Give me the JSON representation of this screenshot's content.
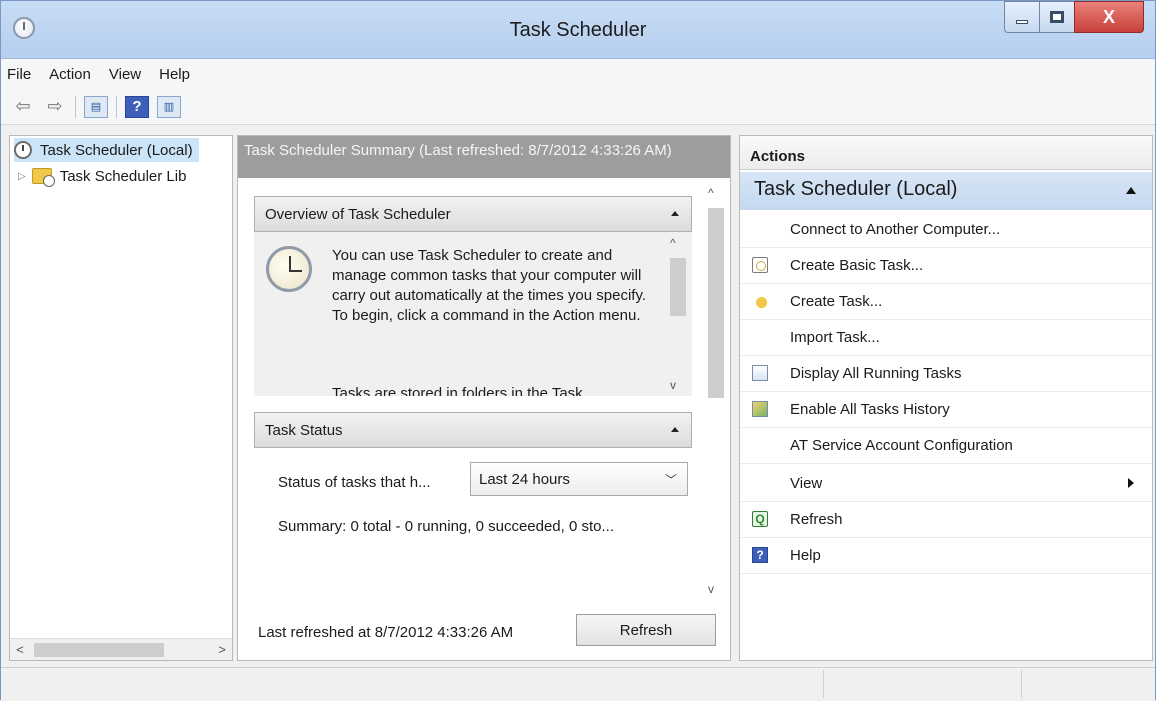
{
  "window": {
    "title": "Task Scheduler",
    "close_glyph": "X"
  },
  "menu": {
    "items": [
      "File",
      "Action",
      "View",
      "Help"
    ]
  },
  "toolbar": {
    "back_glyph": "⇦",
    "forward_glyph": "⇨",
    "help_glyph": "?"
  },
  "tree": {
    "root_label": "Task Scheduler (Local)",
    "library_label": "Task Scheduler Lib",
    "expand_glyph": "▷",
    "scroll_left": "<",
    "scroll_right": ">"
  },
  "center": {
    "header": "Task Scheduler Summary (Last refreshed: 8/7/2012 4:33:26 AM)",
    "overview": {
      "title": "Overview of Task Scheduler",
      "text": "You can use Task Scheduler to create and manage common tasks that your computer will carry out automatically at the times you specify. To begin, click a command in the Action menu.",
      "text2": "Tasks are stored in folders in the Task"
    },
    "task_status": {
      "title": "Task Status",
      "filter_label": "Status of tasks that h...",
      "filter_value": "Last 24 hours",
      "summary": "Summary: 0 total - 0 running, 0 succeeded, 0 sto..."
    },
    "footer": {
      "last_refreshed": "Last refreshed at 8/7/2012 4:33:26 AM",
      "refresh_label": "Refresh"
    },
    "scroll_up": "^",
    "scroll_down": "v"
  },
  "actions": {
    "header": "Actions",
    "group_title": "Task Scheduler (Local)",
    "items": [
      {
        "label": "Connect to Another Computer...",
        "icon": "none"
      },
      {
        "label": "Create Basic Task...",
        "icon": "basic-task-icon"
      },
      {
        "label": "Create Task...",
        "icon": "create-task-icon"
      },
      {
        "label": "Import Task...",
        "icon": "none"
      },
      {
        "label": "Display All Running Tasks",
        "icon": "running-tasks-icon"
      },
      {
        "label": "Enable All Tasks History",
        "icon": "history-icon"
      },
      {
        "label": "AT Service Account Configuration",
        "icon": "none"
      },
      {
        "label": "View",
        "icon": "none"
      },
      {
        "label": "Refresh",
        "icon": "refresh-icon"
      },
      {
        "label": "Help",
        "icon": "help-icon"
      }
    ],
    "refresh_glyph": "Q",
    "help_glyph": "?"
  },
  "colors": {
    "title_bar": "#c7dcf5",
    "summary_header": "#9d9d9d",
    "selection": "#cce4f7",
    "close_button": "#c9413a"
  }
}
